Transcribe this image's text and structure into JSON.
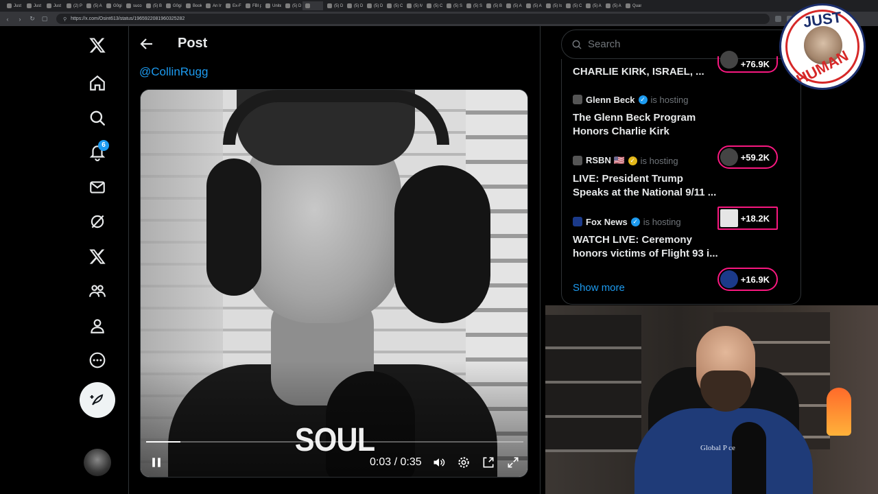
{
  "browser": {
    "url": "https://x.com/Osint613/status/1965922081960325282",
    "tabs": [
      "Just",
      "Just",
      "Just",
      "(2) P",
      "(5) A",
      "G0gi",
      "succe",
      "(5) B",
      "G0gi",
      "Book",
      "An In",
      "Ex-FI",
      "FBI p",
      "Unite",
      "(5) D",
      "",
      "(5) D",
      "(5) D",
      "(5) D",
      "(5) C",
      "(5) M",
      "(5) C",
      "(5) Se",
      "(5) S",
      "(5) B",
      "(5) A",
      "(5) A",
      "(5) Is",
      "(5) C",
      "(5) A",
      "(5) A",
      "Quan"
    ]
  },
  "nav": {
    "notifications_badge": "6"
  },
  "post": {
    "title": "Post",
    "mention": "@CollinRugg"
  },
  "video": {
    "caption": "SOUL",
    "current_time": "0:03",
    "separator": "/",
    "duration": "0:35",
    "progress_fraction": 0.09
  },
  "search": {
    "placeholder": "Search"
  },
  "spaces": {
    "partial_title": "CHARLIE KIRK, ISRAEL, ...",
    "partial_listeners": "+76.9K",
    "hosting_label": "is hosting",
    "items": [
      {
        "host": "Glenn Beck",
        "title_line1": "The Glenn Beck Program",
        "title_line2": "Honors Charlie Kirk",
        "listeners": "+59.2K",
        "verified": "blue"
      },
      {
        "host": "RSBN 🇺🇸",
        "title_line1": "LIVE: President Trump",
        "title_line2": "Speaks at the National 9/11 ...",
        "listeners": "+18.2K",
        "verified": "gold"
      },
      {
        "host": "Fox News",
        "title_line1": "WATCH LIVE: Ceremony",
        "title_line2": "honors victims of Flight 93 i...",
        "listeners": "+16.9K",
        "verified": "gold"
      }
    ],
    "show_more": "Show more"
  },
  "logo": {
    "top_word": "JUST",
    "bottom_word": "HUMAN"
  },
  "webcam": {
    "shirt_text": "Global P        ce"
  },
  "colors": {
    "accent": "#1d9bf0",
    "live_ring": "#f91880",
    "background": "#000000",
    "border": "#2f3336"
  }
}
